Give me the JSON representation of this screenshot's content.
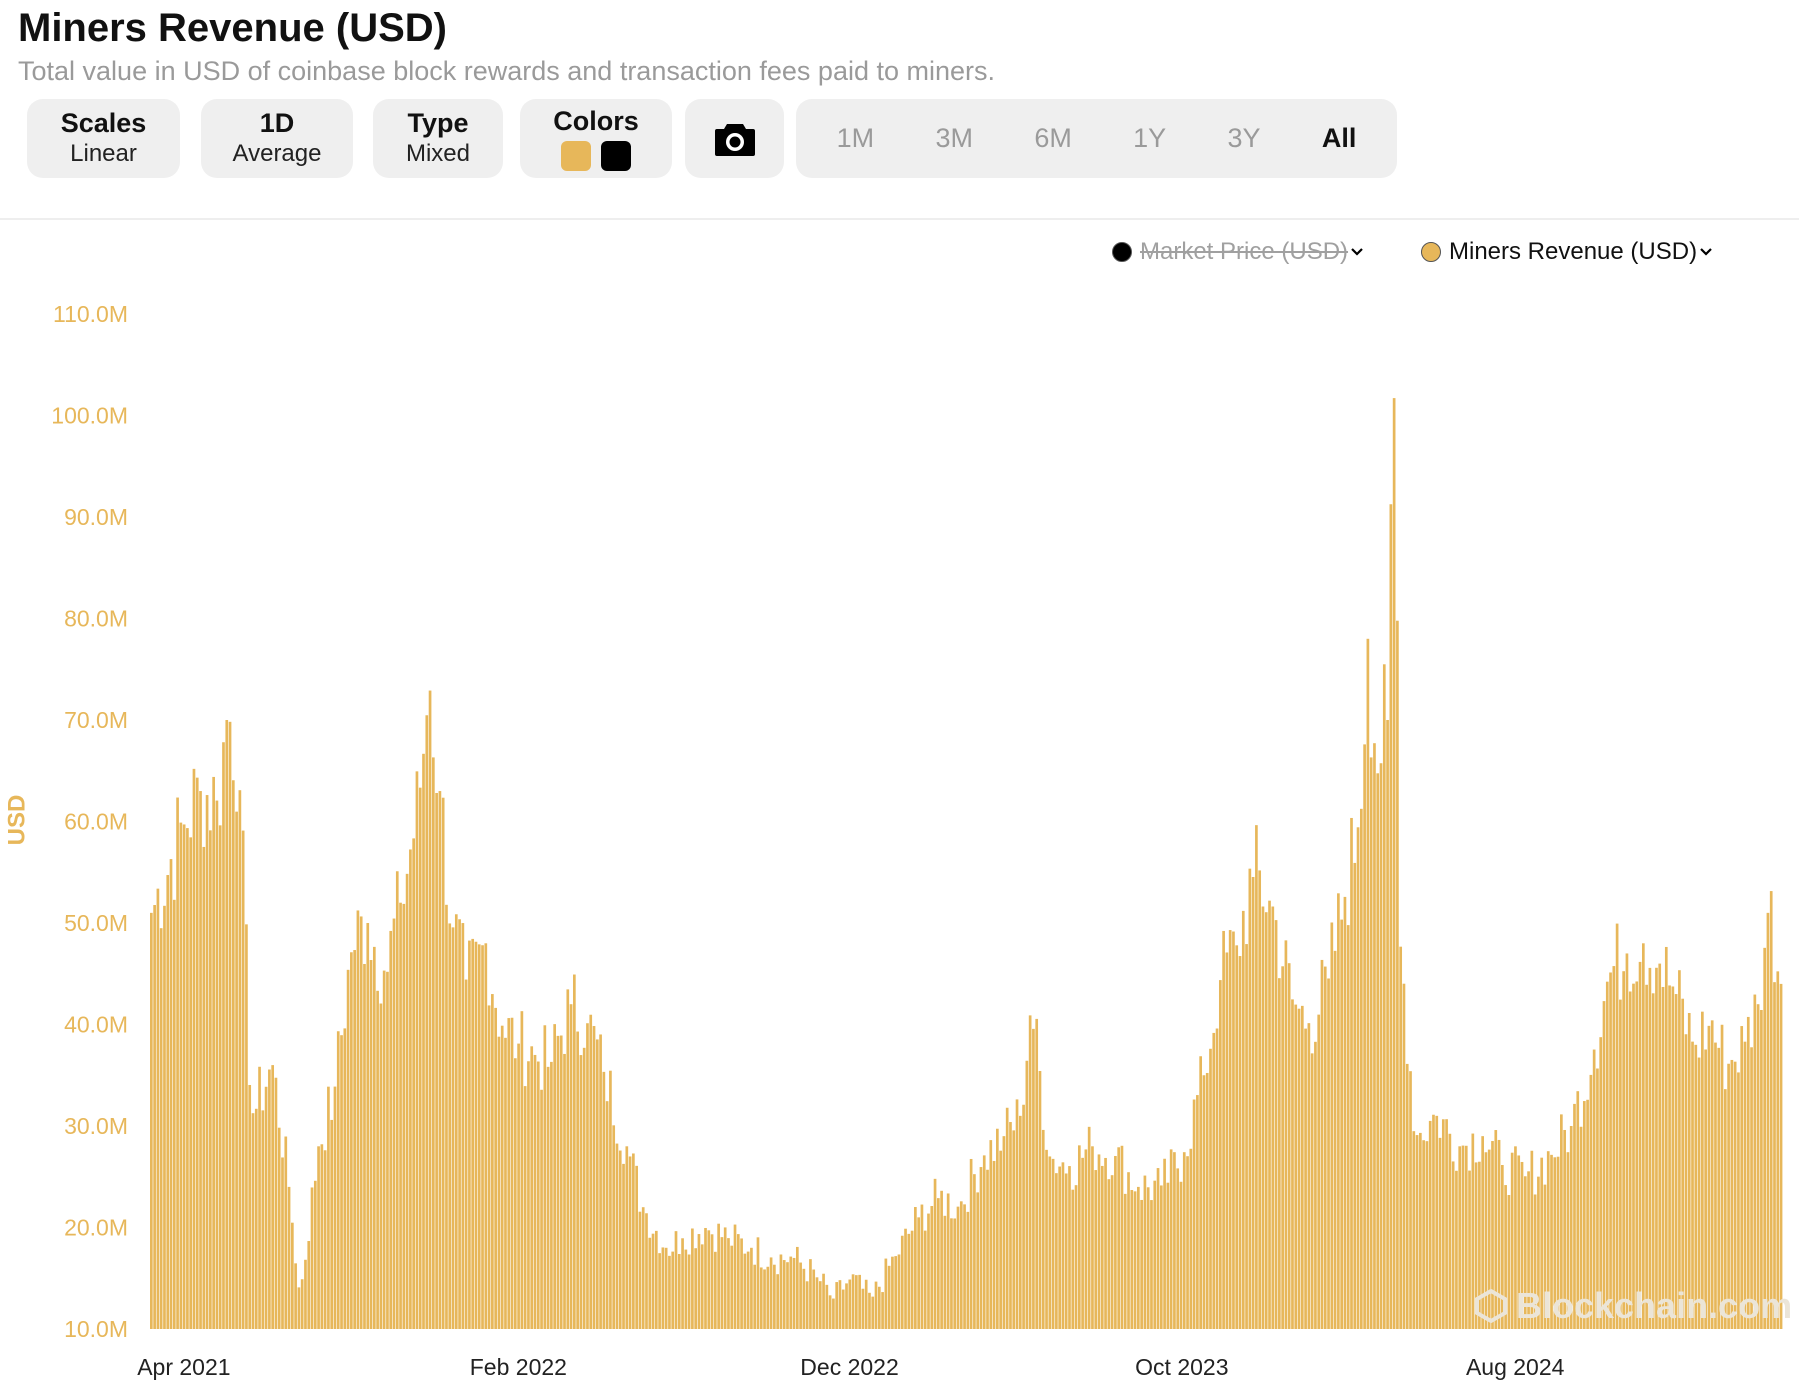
{
  "header": {
    "title": "Miners Revenue (USD)",
    "subtitle": "Total value in USD of coinbase block rewards and transaction fees paid to miners."
  },
  "controls": {
    "scales": {
      "label": "Scales",
      "value": "Linear"
    },
    "interval": {
      "label": "1D",
      "value": "Average"
    },
    "type": {
      "label": "Type",
      "value": "Mixed"
    },
    "colors": {
      "label": "Colors",
      "swatches": [
        "#E7B75A",
        "#000000"
      ]
    },
    "camera_icon": "camera-icon",
    "ranges": [
      "1M",
      "3M",
      "6M",
      "1Y",
      "3Y",
      "All"
    ],
    "active_range": "All"
  },
  "legend": [
    {
      "label": "Market Price (USD)",
      "color": "#000000",
      "hidden": true
    },
    {
      "label": "Miners Revenue (USD)",
      "color": "#E7B75A",
      "hidden": false
    }
  ],
  "watermark": "Blockchain.com",
  "chart_data": {
    "type": "bar",
    "title": "Miners Revenue (USD)",
    "ylabel": "USD",
    "ylim": [
      10,
      110
    ],
    "y_unit": "M",
    "yticks": [
      "10.0M",
      "20.0M",
      "30.0M",
      "40.0M",
      "50.0M",
      "60.0M",
      "70.0M",
      "80.0M",
      "90.0M",
      "100.0M",
      "110.0M"
    ],
    "xticks": [
      "Apr 2021",
      "Feb 2022",
      "Dec 2022",
      "Oct 2023",
      "Aug 2024"
    ],
    "color": "#E7B75A",
    "grid": false,
    "legend_position": "top-right",
    "anchors": [
      [
        "2021-03-01",
        51
      ],
      [
        "2021-04-01",
        60
      ],
      [
        "2021-04-15",
        63
      ],
      [
        "2021-05-01",
        62
      ],
      [
        "2021-05-10",
        71
      ],
      [
        "2021-05-20",
        66
      ],
      [
        "2021-06-01",
        31
      ],
      [
        "2021-06-20",
        36
      ],
      [
        "2021-07-05",
        24
      ],
      [
        "2021-07-15",
        13
      ],
      [
        "2021-08-01",
        28
      ],
      [
        "2021-08-15",
        33
      ],
      [
        "2021-09-01",
        48
      ],
      [
        "2021-09-15",
        50
      ],
      [
        "2021-10-01",
        45
      ],
      [
        "2021-10-15",
        52
      ],
      [
        "2021-11-01",
        62
      ],
      [
        "2021-11-10",
        74
      ],
      [
        "2021-11-20",
        63
      ],
      [
        "2021-12-01",
        50
      ],
      [
        "2021-12-15",
        44
      ],
      [
        "2022-01-01",
        48
      ],
      [
        "2022-01-15",
        40
      ],
      [
        "2022-02-01",
        38
      ],
      [
        "2022-02-15",
        37
      ],
      [
        "2022-03-01",
        36
      ],
      [
        "2022-03-20",
        42
      ],
      [
        "2022-04-05",
        40
      ],
      [
        "2022-04-20",
        35
      ],
      [
        "2022-05-10",
        28
      ],
      [
        "2022-05-25",
        22
      ],
      [
        "2022-06-15",
        18
      ],
      [
        "2022-07-01",
        19
      ],
      [
        "2022-07-20",
        20
      ],
      [
        "2022-08-10",
        19
      ],
      [
        "2022-09-01",
        18
      ],
      [
        "2022-09-20",
        17
      ],
      [
        "2022-10-10",
        17
      ],
      [
        "2022-11-01",
        15
      ],
      [
        "2022-11-15",
        13
      ],
      [
        "2022-12-01",
        15
      ],
      [
        "2022-12-20",
        13
      ],
      [
        "2023-01-10",
        17
      ],
      [
        "2023-02-01",
        21
      ],
      [
        "2023-02-20",
        23
      ],
      [
        "2023-03-10",
        22
      ],
      [
        "2023-04-01",
        27
      ],
      [
        "2023-04-20",
        29
      ],
      [
        "2023-05-05",
        31
      ],
      [
        "2023-05-15",
        42
      ],
      [
        "2023-06-01",
        27
      ],
      [
        "2023-06-20",
        26
      ],
      [
        "2023-07-10",
        28
      ],
      [
        "2023-08-01",
        27
      ],
      [
        "2023-08-20",
        24
      ],
      [
        "2023-09-10",
        24
      ],
      [
        "2023-10-01",
        27
      ],
      [
        "2023-10-20",
        35
      ],
      [
        "2023-11-05",
        45
      ],
      [
        "2023-11-20",
        48
      ],
      [
        "2023-12-05",
        55
      ],
      [
        "2023-12-20",
        52
      ],
      [
        "2024-01-10",
        42
      ],
      [
        "2024-01-25",
        40
      ],
      [
        "2024-02-10",
        44
      ],
      [
        "2024-02-25",
        52
      ],
      [
        "2024-03-10",
        60
      ],
      [
        "2024-03-18",
        78
      ],
      [
        "2024-03-25",
        66
      ],
      [
        "2024-04-05",
        70
      ],
      [
        "2024-04-12",
        107
      ],
      [
        "2024-04-16",
        49
      ],
      [
        "2024-05-01",
        29
      ],
      [
        "2024-05-20",
        31
      ],
      [
        "2024-06-10",
        28
      ],
      [
        "2024-07-01",
        29
      ],
      [
        "2024-07-20",
        26
      ],
      [
        "2024-08-10",
        25
      ],
      [
        "2024-09-01",
        27
      ],
      [
        "2024-09-20",
        30
      ],
      [
        "2024-10-10",
        37
      ],
      [
        "2024-10-25",
        45
      ],
      [
        "2024-11-10",
        47
      ],
      [
        "2024-11-25",
        48
      ],
      [
        "2024-12-10",
        46
      ],
      [
        "2024-12-25",
        43
      ],
      [
        "2025-01-10",
        38
      ],
      [
        "2025-01-25",
        40
      ],
      [
        "2025-02-10",
        36
      ],
      [
        "2025-02-25",
        38
      ],
      [
        "2025-03-10",
        42
      ],
      [
        "2025-03-20",
        52
      ],
      [
        "2025-03-31",
        44
      ]
    ]
  }
}
